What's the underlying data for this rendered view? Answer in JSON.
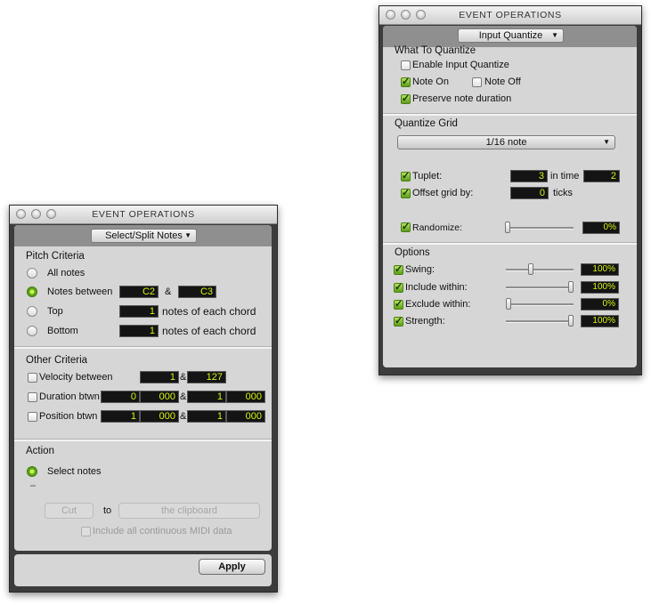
{
  "left_window": {
    "title": "EVENT OPERATIONS",
    "mode_select": "Select/Split Notes",
    "pitch_criteria": {
      "heading": "Pitch Criteria",
      "all_notes": "All notes",
      "notes_between": "Notes between",
      "notes_between_low": "C2",
      "notes_between_and": "&",
      "notes_between_high": "C3",
      "top": "Top",
      "top_value": "1",
      "top_suffix": "notes of each chord",
      "bottom": "Bottom",
      "bottom_value": "1",
      "bottom_suffix": "notes of each chord",
      "selected": "notes_between"
    },
    "other_criteria": {
      "heading": "Other Criteria",
      "velocity_label": "Velocity between",
      "velocity_low": "1",
      "velocity_and": "&",
      "velocity_high": "127",
      "duration_label": "Duration btwn",
      "duration_a1": "0",
      "duration_a2": "000",
      "duration_and": "&",
      "duration_b1": "1",
      "duration_b2": "000",
      "position_label": "Position btwn",
      "position_a1": "1",
      "position_a2": "000",
      "position_and": "&",
      "position_b1": "1",
      "position_b2": "000"
    },
    "action": {
      "heading": "Action",
      "select_notes": "Select notes",
      "cut_button": "Cut",
      "to_label": "to",
      "destination": "the clipboard",
      "include_midi": "Include all continuous MIDI data"
    },
    "apply_button": "Apply"
  },
  "right_window": {
    "title": "EVENT OPERATIONS",
    "mode_select": "Input Quantize",
    "what_to_quantize": {
      "heading": "What To Quantize",
      "enable_input_quantize": "Enable Input Quantize",
      "note_on": "Note On",
      "note_off": "Note Off",
      "preserve_duration": "Preserve note duration"
    },
    "quantize_grid": {
      "heading": "Quantize Grid",
      "grid_value": "1/16 note",
      "tuplet_label": "Tuplet:",
      "tuplet_value": "3",
      "in_time_label": "in time",
      "in_time_value": "2",
      "offset_label": "Offset grid by:",
      "offset_value": "0",
      "ticks_label": "ticks",
      "randomize_label": "Randomize:",
      "randomize_value": "0%",
      "randomize_level": 0
    },
    "options": {
      "heading": "Options",
      "swing_label": "Swing:",
      "swing_value": "100%",
      "swing_level": 0.35,
      "include_label": "Include within:",
      "include_value": "100%",
      "include_level": 1.0,
      "exclude_label": "Exclude within:",
      "exclude_value": "0%",
      "exclude_level": 0,
      "strength_label": "Strength:",
      "strength_value": "100%",
      "strength_level": 1.0
    }
  },
  "colors": {
    "field_text": "#d6f20a",
    "check_green": "#5b9d1a",
    "panel_gray": "#d6d6d6",
    "window_dark": "#3c3c3c"
  },
  "icons": [
    "close-icon",
    "minimize-icon",
    "zoom-icon",
    "chevron-down-icon",
    "checkmark-icon",
    "radio-dot-icon"
  ]
}
